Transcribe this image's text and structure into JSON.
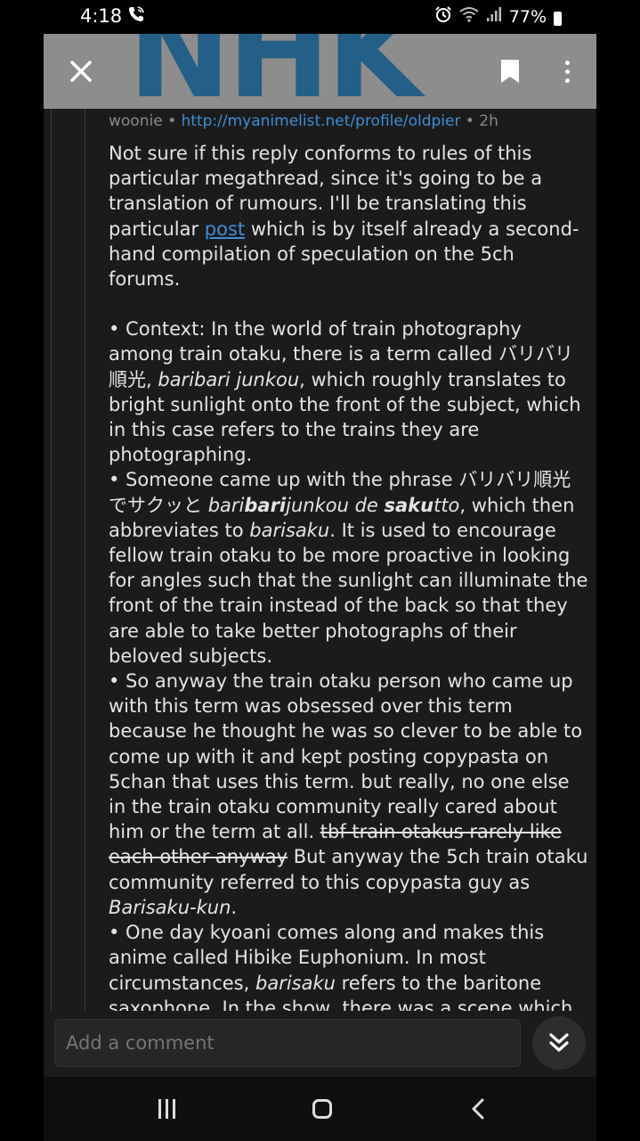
{
  "status_bar": {
    "time": "4:18",
    "battery": "77%",
    "icons": [
      "phone-icon",
      "alarm-icon",
      "wifi-icon",
      "signal-icon",
      "battery-icon"
    ]
  },
  "header": {
    "logo_text": "NHK",
    "icons": [
      "close-icon",
      "bookmark-icon",
      "more-icon"
    ],
    "colors": {
      "background": "#8d8d8d",
      "logo": "#1b5c86"
    }
  },
  "comment": {
    "author": "woonie",
    "separator": " • ",
    "flair_link": "http://myanimelist.net/profile/oldpier",
    "age": "2h",
    "intro": {
      "part1": "Not sure if this reply conforms to rules of this particular megathread, since it's going to be a translation of rumours. I'll be translating this particular ",
      "link_text": "post",
      "part2": " which is by itself already a second-hand compilation of speculation on the 5ch forums."
    },
    "bullets": {
      "b1_a": "• Context: In the world of train photography among train otaku, there is a term called バリバリ順光, ",
      "b1_i": "baribari junkou",
      "b1_b": ", which roughly translates to bright sunlight onto the front of the subject, which in this case refers to the trains they are photographing.",
      "b2_a": "• Someone came up with the phrase バリバリ順光でサクッと ",
      "b2_i1": "bari",
      "b2_ib1": "bari",
      "b2_i2": "junkou de ",
      "b2_ib2": "saku",
      "b2_i3": "tto",
      "b2_b": ", which then abbreviates to ",
      "b2_i4": "barisaku",
      "b2_c": ". It is used to encourage fellow train otaku to be more proactive in looking for angles such that the sunlight can illuminate the front of the train instead of the back so that they are able to take better photographs of their beloved subjects.",
      "b3_a": "• So anyway the train otaku person who came up with this term was obsessed over this term because he thought he was so clever to be able to come up with it and kept posting copypasta on 5chan that uses this term. but really, no one else in the train otaku community really cared about him or the term at all. ",
      "b3_strike": "tbf train otakus rarely like each other anyway",
      "b3_b": " But anyway the 5ch train otaku community referred to this copypasta guy as ",
      "b3_i": "Barisaku-kun",
      "b3_c": ".",
      "b4_a": "• One day kyoani comes along and makes this anime called Hibike Euphonium. In most circumstances, ",
      "b4_i": "barisaku",
      "b4_b": " refers to the baritone saxophone. In the show, there was a scene which features a baritone saxophone solo"
    }
  },
  "comment_bar": {
    "placeholder": "Add a comment",
    "jump_icon": "double-chevron-down-icon"
  },
  "nav_bar": {
    "icons": [
      "recents-icon",
      "home-icon",
      "back-icon"
    ]
  }
}
